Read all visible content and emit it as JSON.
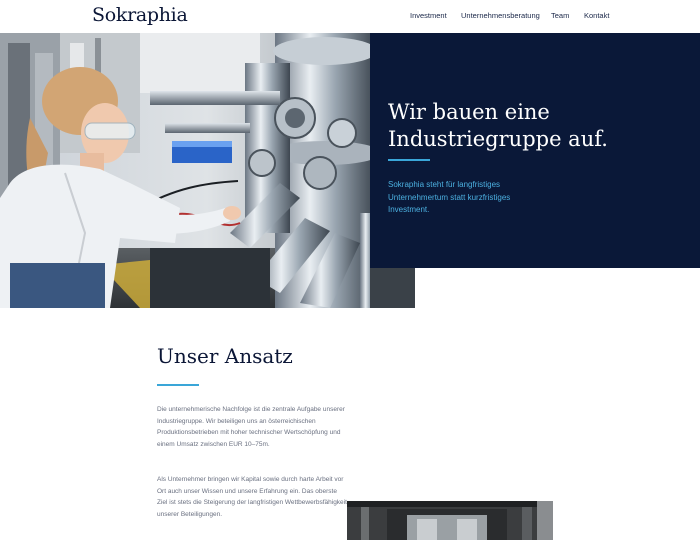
{
  "header": {
    "logo": "Sokraphia",
    "nav": [
      {
        "label": "Investment"
      },
      {
        "label": "Unternehmensberatung"
      },
      {
        "label": "Team"
      },
      {
        "label": "Kontakt"
      }
    ]
  },
  "hero": {
    "title_line1": "Wir bauen eine",
    "title_line2": "Industriegruppe auf.",
    "subtitle": "Sokraphia steht für langfristiges Unternehmertum statt kurzfristiges Investment.",
    "colors": {
      "panel": "#0a1838",
      "accent": "#3aa6d8",
      "subtitle": "#4cb0e0"
    }
  },
  "approach": {
    "title": "Unser Ansatz",
    "paragraph1": "Die unternehmerische Nachfolge ist die zentrale Aufgabe unserer Industriegruppe. Wir beteiligen uns an österreichischen Produktionsbetrieben mit hoher technischer Wertschöpfung und einem Umsatz zwischen EUR 10–75m.",
    "paragraph2": "Als Unternehmer bringen wir Kapital sowie durch harte Arbeit vor Ort auch unser Wissen und unsere Erfahrung ein. Das oberste Ziel ist stets die Steigerung der langfristigen Wettbewerbsfähigkeit unserer Beteiligungen."
  }
}
